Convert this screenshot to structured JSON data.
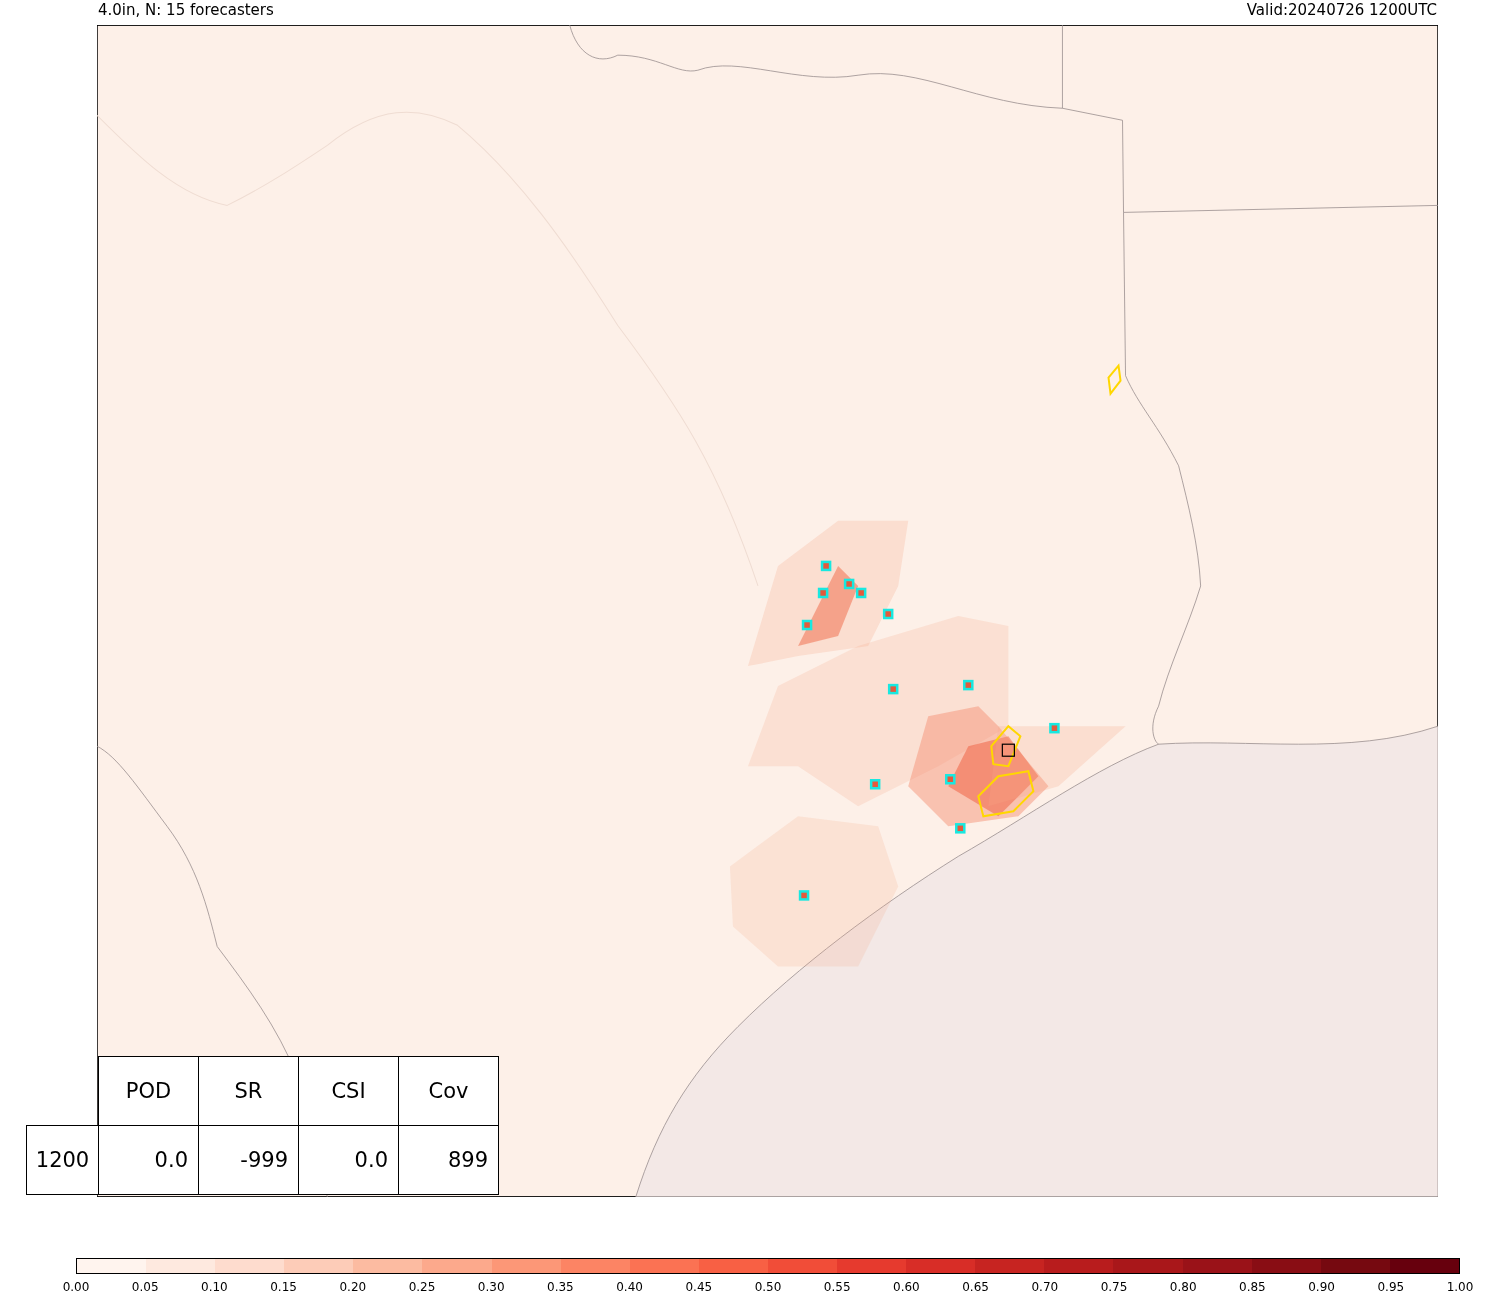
{
  "header": {
    "left": "4.0in, N: 15 forecasters",
    "right": "Valid:20240726 1200UTC"
  },
  "table": {
    "columns": [
      "POD",
      "SR",
      "CSI",
      "Cov"
    ],
    "rows": [
      {
        "label": "1200",
        "cells": [
          "0.0",
          "-999",
          "0.0",
          "899"
        ]
      }
    ]
  },
  "colorbar": {
    "segments": [
      {
        "color": "#fff4ee"
      },
      {
        "color": "#fee9df"
      },
      {
        "color": "#fedcce"
      },
      {
        "color": "#fdccb8"
      },
      {
        "color": "#fcbba1"
      },
      {
        "color": "#fca98c"
      },
      {
        "color": "#fc9777"
      },
      {
        "color": "#fc8464"
      },
      {
        "color": "#fb7253"
      },
      {
        "color": "#f86044"
      },
      {
        "color": "#f14d38"
      },
      {
        "color": "#e63a2e"
      },
      {
        "color": "#d82d27"
      },
      {
        "color": "#c72421"
      },
      {
        "color": "#b81c1d"
      },
      {
        "color": "#a9171a"
      },
      {
        "color": "#9a1218"
      },
      {
        "color": "#890d14"
      },
      {
        "color": "#760910"
      },
      {
        "color": "#67000d"
      }
    ],
    "ticks": [
      "0.00",
      "0.05",
      "0.10",
      "0.15",
      "0.20",
      "0.25",
      "0.30",
      "0.35",
      "0.40",
      "0.45",
      "0.50",
      "0.55",
      "0.60",
      "0.65",
      "0.70",
      "0.75",
      "0.80",
      "0.85",
      "0.90",
      "0.95",
      "1.00"
    ]
  }
}
